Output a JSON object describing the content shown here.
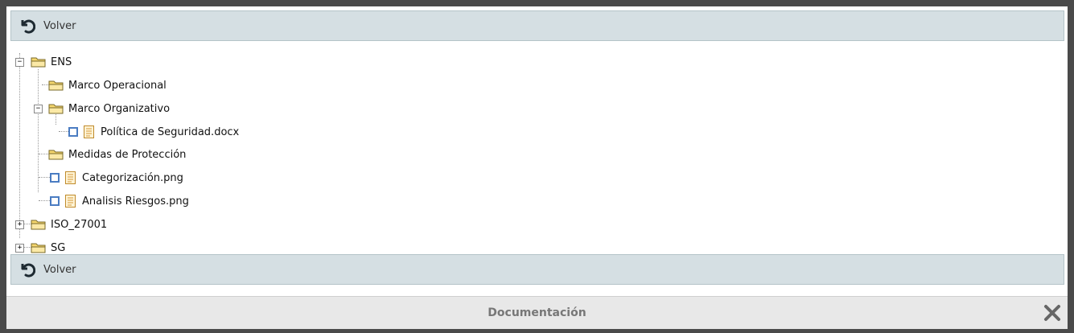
{
  "toolbar_top": {
    "back_label": "Volver",
    "icon": "undo-icon"
  },
  "toolbar_bottom": {
    "back_label": "Volver",
    "icon": "undo-icon"
  },
  "tree": {
    "nodes": [
      {
        "label": "ENS",
        "type": "folder",
        "state": "expanded"
      },
      {
        "label": "Marco Operacional",
        "type": "folder"
      },
      {
        "label": "Marco Organizativo",
        "type": "folder",
        "state": "expanded"
      },
      {
        "label": "Política de Seguridad.docx",
        "type": "file",
        "checked": false
      },
      {
        "label": "Medidas de Protección",
        "type": "folder"
      },
      {
        "label": "Categorización.png",
        "type": "file",
        "checked": false
      },
      {
        "label": "Analisis Riesgos.png",
        "type": "file",
        "checked": false
      },
      {
        "label": "ISO_27001",
        "type": "folder",
        "state": "collapsed"
      },
      {
        "label": "SG",
        "type": "folder",
        "state": "collapsed"
      }
    ]
  },
  "footer": {
    "title": "Documentación",
    "close_icon": "close-icon"
  },
  "colors": {
    "toolbar_bg": "#d5dfe3",
    "checkbox_border": "#4a7cc2",
    "folder_fill": "#f7e08a"
  }
}
